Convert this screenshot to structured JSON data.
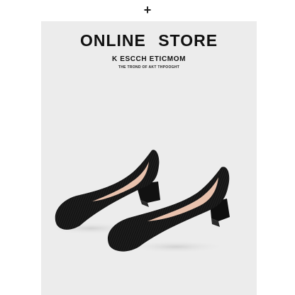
{
  "header": {
    "add_icon": "plus-icon",
    "add_glyph": "+"
  },
  "banner": {
    "title": "ONLINE  STORE",
    "subtitle": "K ESCCH ETICMOM",
    "tagline": "THE TROND OF AKT THPOOGHT"
  },
  "product": {
    "image": "black-knit-square-toe-block-heel-pumps",
    "colors": {
      "shoe": "#151515",
      "lining": "#e9c2ad",
      "background": "#ececec"
    }
  }
}
